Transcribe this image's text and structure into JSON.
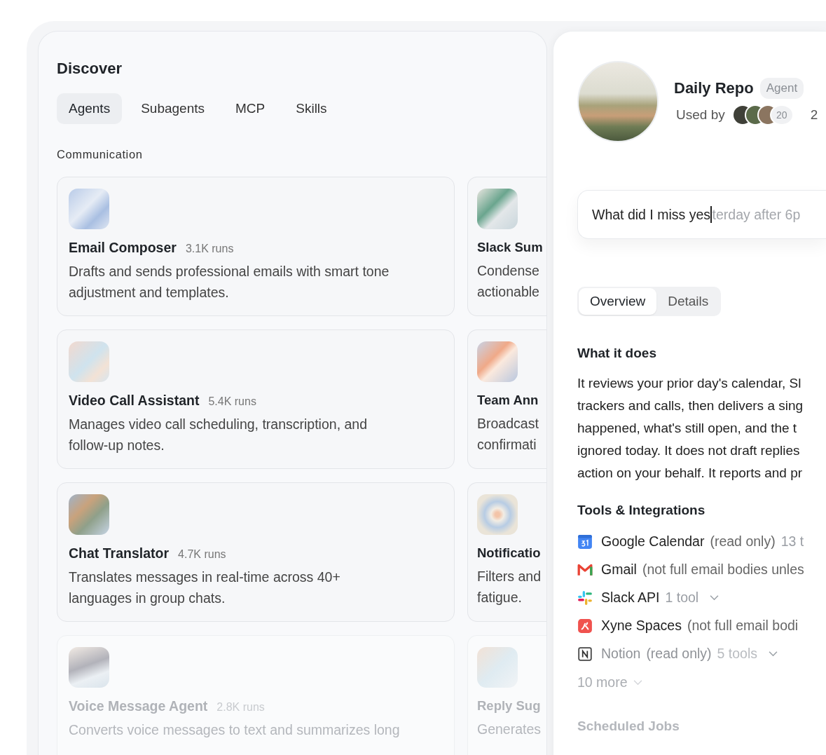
{
  "discover": {
    "title": "Discover",
    "tabs": [
      {
        "label": "Agents",
        "selected": true
      },
      {
        "label": "Subagents",
        "selected": false
      },
      {
        "label": "MCP",
        "selected": false
      },
      {
        "label": "Skills",
        "selected": false
      }
    ],
    "section": "Communication",
    "cards": [
      {
        "kind": "envelope",
        "title": "Email Composer",
        "runs": "3.1K runs",
        "lines": [
          "Drafts and sends professional emails with smart tone",
          "adjustment and templates."
        ],
        "faded": false
      },
      {
        "kind": "swirl",
        "title": "Slack Sum",
        "lines": [
          "Condense",
          "actionable"
        ],
        "faded": false
      },
      {
        "kind": "pastel",
        "title": "Video Call Assistant",
        "runs": "5.4K runs",
        "lines": [
          "Manages video call scheduling, transcription, and",
          "follow-up notes."
        ],
        "faded": false
      },
      {
        "kind": "pinwheel",
        "title": "Team Ann",
        "lines": [
          "Broadcast",
          "confirmati"
        ],
        "faded": false
      },
      {
        "kind": "ribbon",
        "title": "Chat Translator",
        "runs": "4.7K runs",
        "lines": [
          "Translates messages in real-time across 40+",
          "languages in group chats."
        ],
        "faded": false
      },
      {
        "kind": "ripple",
        "title": "Notificatio",
        "lines": [
          "Filters and",
          "fatigue."
        ],
        "faded": false
      },
      {
        "kind": "wave",
        "title": "Voice Message Agent",
        "runs": "2.8K runs",
        "lines": [
          "Converts voice messages to text and summarizes long"
        ],
        "faded": true
      },
      {
        "kind": "mist",
        "title": "Reply Sug",
        "lines": [
          "Generates"
        ],
        "faded": true
      }
    ]
  },
  "detail": {
    "name": "Daily Repo",
    "badge": "Agent",
    "used_by": "Used by",
    "avatars": [
      {
        "color": "#3f4038"
      },
      {
        "color": "#5b6a4a"
      },
      {
        "color": "#8b7560"
      }
    ],
    "user_count": "20",
    "trailing": "2",
    "prompt": {
      "value": "What did I miss yes",
      "suggestion": "terday after 6p"
    },
    "tabs": [
      {
        "label": "Overview",
        "selected": true
      },
      {
        "label": "Details",
        "selected": false
      }
    ],
    "what_title": "What it does",
    "what_lines": [
      "It reviews your prior day's calendar, Sl",
      "trackers and calls, then delivers a sing",
      "happened, what's still open, and the t",
      "ignored today. It does not draft replies",
      "action on your behalf. It reports and pr"
    ],
    "tools_title": "Tools & Integrations",
    "tools": [
      {
        "kind": "calendar",
        "name": "Google Calendar",
        "note": "(read only)",
        "count": "13 t",
        "expandable": false,
        "faded": false
      },
      {
        "kind": "gmail",
        "name": "Gmail",
        "note": "(not full email bodies unles",
        "expandable": false,
        "faded": false
      },
      {
        "kind": "slack",
        "name": "Slack API",
        "count": "1 tool",
        "expandable": true,
        "faded": false
      },
      {
        "kind": "xyne",
        "name": "Xyne Spaces",
        "note": "(not full email bodi",
        "expandable": false,
        "faded": false
      },
      {
        "kind": "notion",
        "name": "Notion",
        "note": "(read only)",
        "count": "5 tools",
        "expandable": true,
        "faded": true
      }
    ],
    "more": "10 more",
    "jobs_title": "Scheduled Jobs"
  }
}
